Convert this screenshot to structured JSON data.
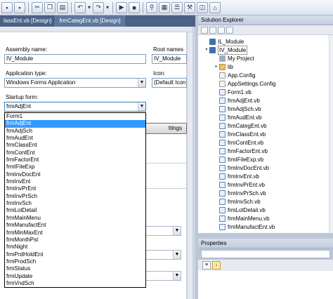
{
  "toolbar": {
    "icons": [
      "save-icon",
      "save-all-icon",
      "cut-icon",
      "copy-icon",
      "paste-icon",
      "undo-icon",
      "redo-icon",
      "run-icon",
      "stop-icon",
      "find-icon",
      "solution-explorer-icon",
      "properties-icon",
      "toolbox-icon"
    ]
  },
  "tabs": [
    {
      "label": "lassEnt.vb [Design]",
      "active": false
    },
    {
      "label": "frmCategEnt.vb [Design]",
      "active": true
    }
  ],
  "app_page": {
    "assembly_name_label": "Assembly name:",
    "assembly_name_value": "IV_Module",
    "root_namespace_label": "Root names",
    "root_namespace_value": "IV_Module",
    "application_type_label": "Application type:",
    "application_type_value": "Windows Forms Application",
    "icon_label": "Icon:",
    "icon_value": "(Default Icon",
    "startup_form_label": "Startup form:",
    "startup_form_value": "frmAdjEnt",
    "settings_button_partial": "ttings"
  },
  "dropdown": {
    "selected": "frmAdjEnt",
    "items": [
      "Form1",
      "frmAdjEnt",
      "frmAdjSch",
      "frmAudEnt",
      "frmClassEnt",
      "frmContEnt",
      "frmFactorEnt",
      "frmIFileExp",
      "frmInvDocEnt",
      "frmInvEnt",
      "frmInvPrEnt",
      "frmInvPrSch",
      "frmInvSch",
      "frmLotDetail",
      "frmMainMenu",
      "frmManufactEnt",
      "frmMinMaxEnt",
      "frmMonthPst",
      "frmNight",
      "frmPrdHoldEnt",
      "frmProdSch",
      "frmStatus",
      "frmUpdate",
      "frmVndSch"
    ]
  },
  "solution_explorer": {
    "title": "Solution Explorer",
    "tree": [
      {
        "label": "IL_Module",
        "icon": "project-icon",
        "level": 1,
        "expander": ""
      },
      {
        "label": "IV_Module",
        "icon": "project-icon",
        "level": 1,
        "expander": "▾",
        "selected": true
      },
      {
        "label": "My Project",
        "icon": "my-project-icon",
        "level": 2,
        "expander": ""
      },
      {
        "label": "lib",
        "icon": "folder-icon",
        "level": 2,
        "expander": "▸"
      },
      {
        "label": "App.Config",
        "icon": "config-icon",
        "level": 2,
        "expander": ""
      },
      {
        "label": "AppSettings.Config",
        "icon": "config-icon",
        "level": 2,
        "expander": ""
      },
      {
        "label": "Form1.vb",
        "icon": "vb-form-icon",
        "level": 2,
        "expander": ""
      },
      {
        "label": "frmAdjEnt.vb",
        "icon": "vb-form-icon",
        "level": 2,
        "expander": ""
      },
      {
        "label": "frmAdjSch.vb",
        "icon": "vb-form-icon",
        "level": 2,
        "expander": ""
      },
      {
        "label": "frmAudEnt.vb",
        "icon": "vb-form-icon",
        "level": 2,
        "expander": ""
      },
      {
        "label": "frmCategEnt.vb",
        "icon": "vb-form-icon",
        "level": 2,
        "expander": ""
      },
      {
        "label": "frmClassEnt.vb",
        "icon": "vb-form-icon",
        "level": 2,
        "expander": ""
      },
      {
        "label": "frmContEnt.vb",
        "icon": "vb-form-icon",
        "level": 2,
        "expander": ""
      },
      {
        "label": "frmFactorEnt.vb",
        "icon": "vb-form-icon",
        "level": 2,
        "expander": ""
      },
      {
        "label": "frmIFileExp.vb",
        "icon": "vb-form-icon",
        "level": 2,
        "expander": ""
      },
      {
        "label": "frmInvDocEnt.vb",
        "icon": "vb-form-icon",
        "level": 2,
        "expander": ""
      },
      {
        "label": "frmInvEnt.vb",
        "icon": "vb-form-icon",
        "level": 2,
        "expander": ""
      },
      {
        "label": "frmInvPrEnt.vb",
        "icon": "vb-form-icon",
        "level": 2,
        "expander": ""
      },
      {
        "label": "frmInvPrSch.vb",
        "icon": "vb-form-icon",
        "level": 2,
        "expander": ""
      },
      {
        "label": "frmInvSch.vb",
        "icon": "vb-form-icon",
        "level": 2,
        "expander": ""
      },
      {
        "label": "frmLotDetail.vb",
        "icon": "vb-form-icon",
        "level": 2,
        "expander": ""
      },
      {
        "label": "frmMainMenu.vb",
        "icon": "vb-form-icon",
        "level": 2,
        "expander": ""
      },
      {
        "label": "frmManufactEnt.vb",
        "icon": "vb-form-icon",
        "level": 2,
        "expander": ""
      }
    ]
  },
  "properties": {
    "title": "Properties",
    "toolbar_icons": [
      "categorized-icon",
      "alphabetical-icon"
    ]
  },
  "colors": {
    "dropdown_selection": "#3399ff",
    "tab_strip": "#4b6186"
  }
}
